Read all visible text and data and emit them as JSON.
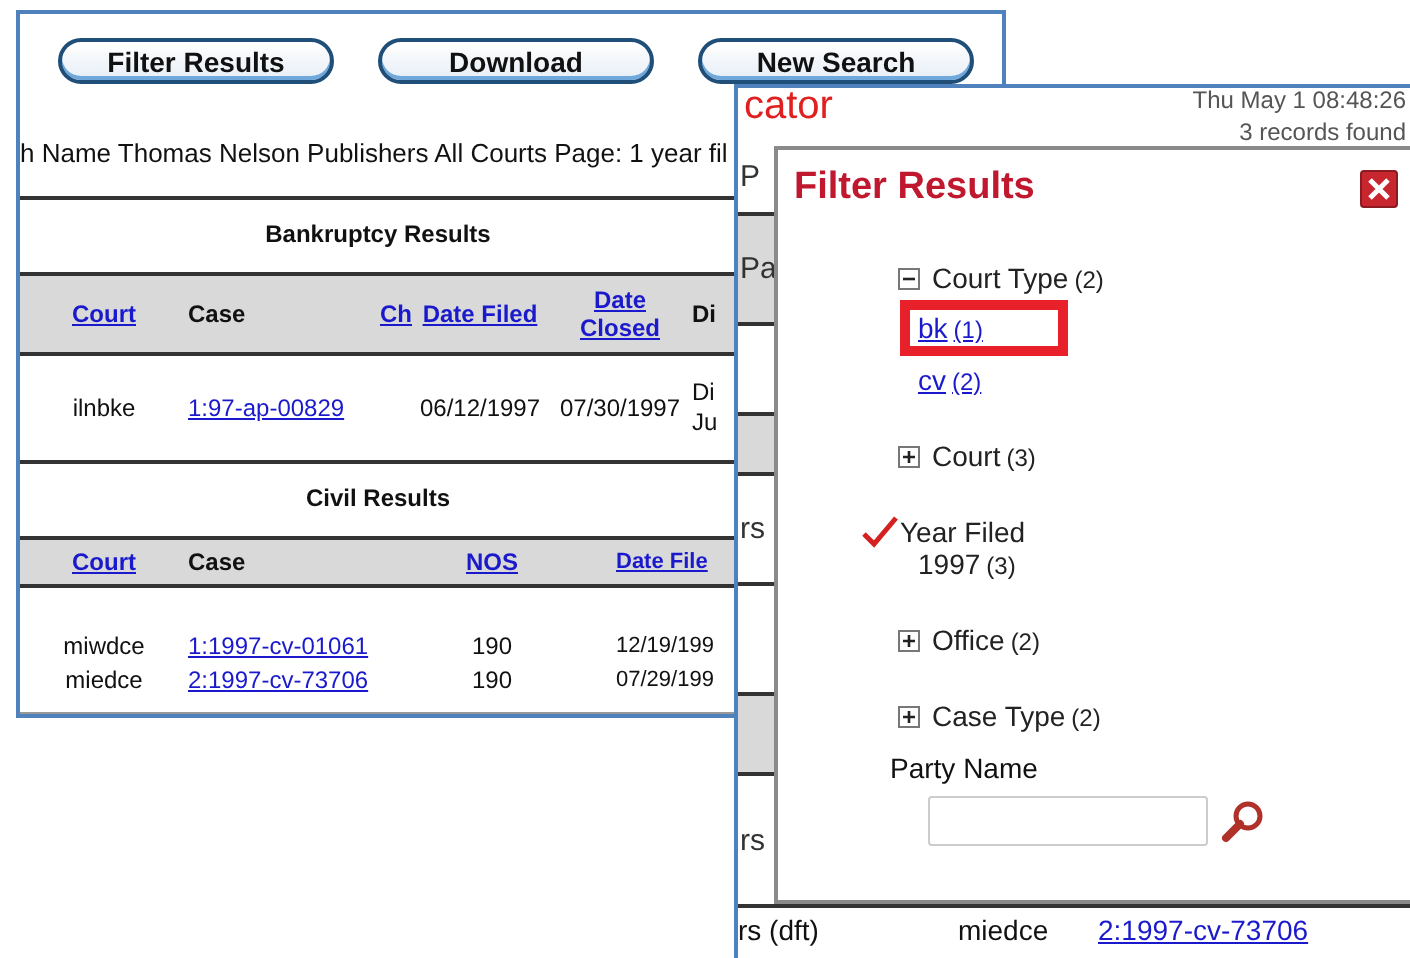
{
  "back_window": {
    "buttons": [
      "Filter Results",
      "Download",
      "New Search"
    ],
    "search_summary": "h Name Thomas Nelson Publishers All Courts Page: 1 year fil",
    "bankruptcy": {
      "title": "Bankruptcy Results",
      "columns": [
        {
          "label": "Court",
          "link": true
        },
        {
          "label": "Case",
          "link": false
        },
        {
          "label": "Ch",
          "link": true
        },
        {
          "label": "Date Filed",
          "link": true
        },
        {
          "label": "Date Closed",
          "link": true
        },
        {
          "label": "Di",
          "link": false
        }
      ],
      "rows": [
        {
          "court": "ilnbke",
          "case": "1:97-ap-00829",
          "date_filed": "06/12/1997",
          "date_closed": "07/30/1997",
          "column_6": [
            "Di",
            "Ju"
          ]
        }
      ]
    },
    "civil": {
      "title": "Civil Results",
      "columns": [
        {
          "label": "Court",
          "link": true
        },
        {
          "label": "Case",
          "link": false
        },
        {
          "label": "NOS",
          "link": true
        },
        {
          "label": "Date File",
          "link": true
        }
      ],
      "rows": [
        {
          "court": "miwdce",
          "case": "1:1997-cv-01061",
          "nos": "190",
          "date_filed": "12/19/199"
        },
        {
          "court": "miedce",
          "case": "2:1997-cv-73706",
          "nos": "190",
          "date_filed": "07/29/199"
        }
      ]
    }
  },
  "front_window": {
    "logo_fragment": "cator",
    "timestamp": "Thu May 1 08:48:26",
    "records": "3 records found",
    "side_rows": [
      {
        "text": "P",
        "shaded": false
      },
      {
        "text": "Pa",
        "shaded": true
      },
      {
        "text": "",
        "shaded": false
      },
      {
        "text": "",
        "shaded": true
      },
      {
        "text": "rs",
        "shaded": false
      },
      {
        "text": "",
        "shaded": false
      },
      {
        "text": "",
        "shaded": true
      },
      {
        "text": "rs",
        "shaded": false
      }
    ],
    "bottom_row": {
      "party": "rs (dft)",
      "court": "miedce",
      "case": "2:1997-cv-73706"
    }
  },
  "filter_dialog": {
    "title": "Filter Results",
    "groups": [
      {
        "kind": "expanded",
        "label": "Court Type",
        "count": "(2)",
        "options": [
          {
            "label": "bk",
            "count": "(1)",
            "highlighted": true
          },
          {
            "label": "cv",
            "count": "(2)",
            "highlighted": false
          }
        ]
      },
      {
        "kind": "collapsed",
        "label": "Court",
        "count": "(3)"
      },
      {
        "kind": "applied",
        "label": "Year Filed",
        "options": [
          {
            "label": "1997",
            "count": "(3)"
          }
        ]
      },
      {
        "kind": "collapsed",
        "label": "Office",
        "count": "(2)"
      },
      {
        "kind": "collapsed",
        "label": "Case Type",
        "count": "(2)"
      }
    ],
    "party_name": {
      "label": "Party Name"
    }
  }
}
